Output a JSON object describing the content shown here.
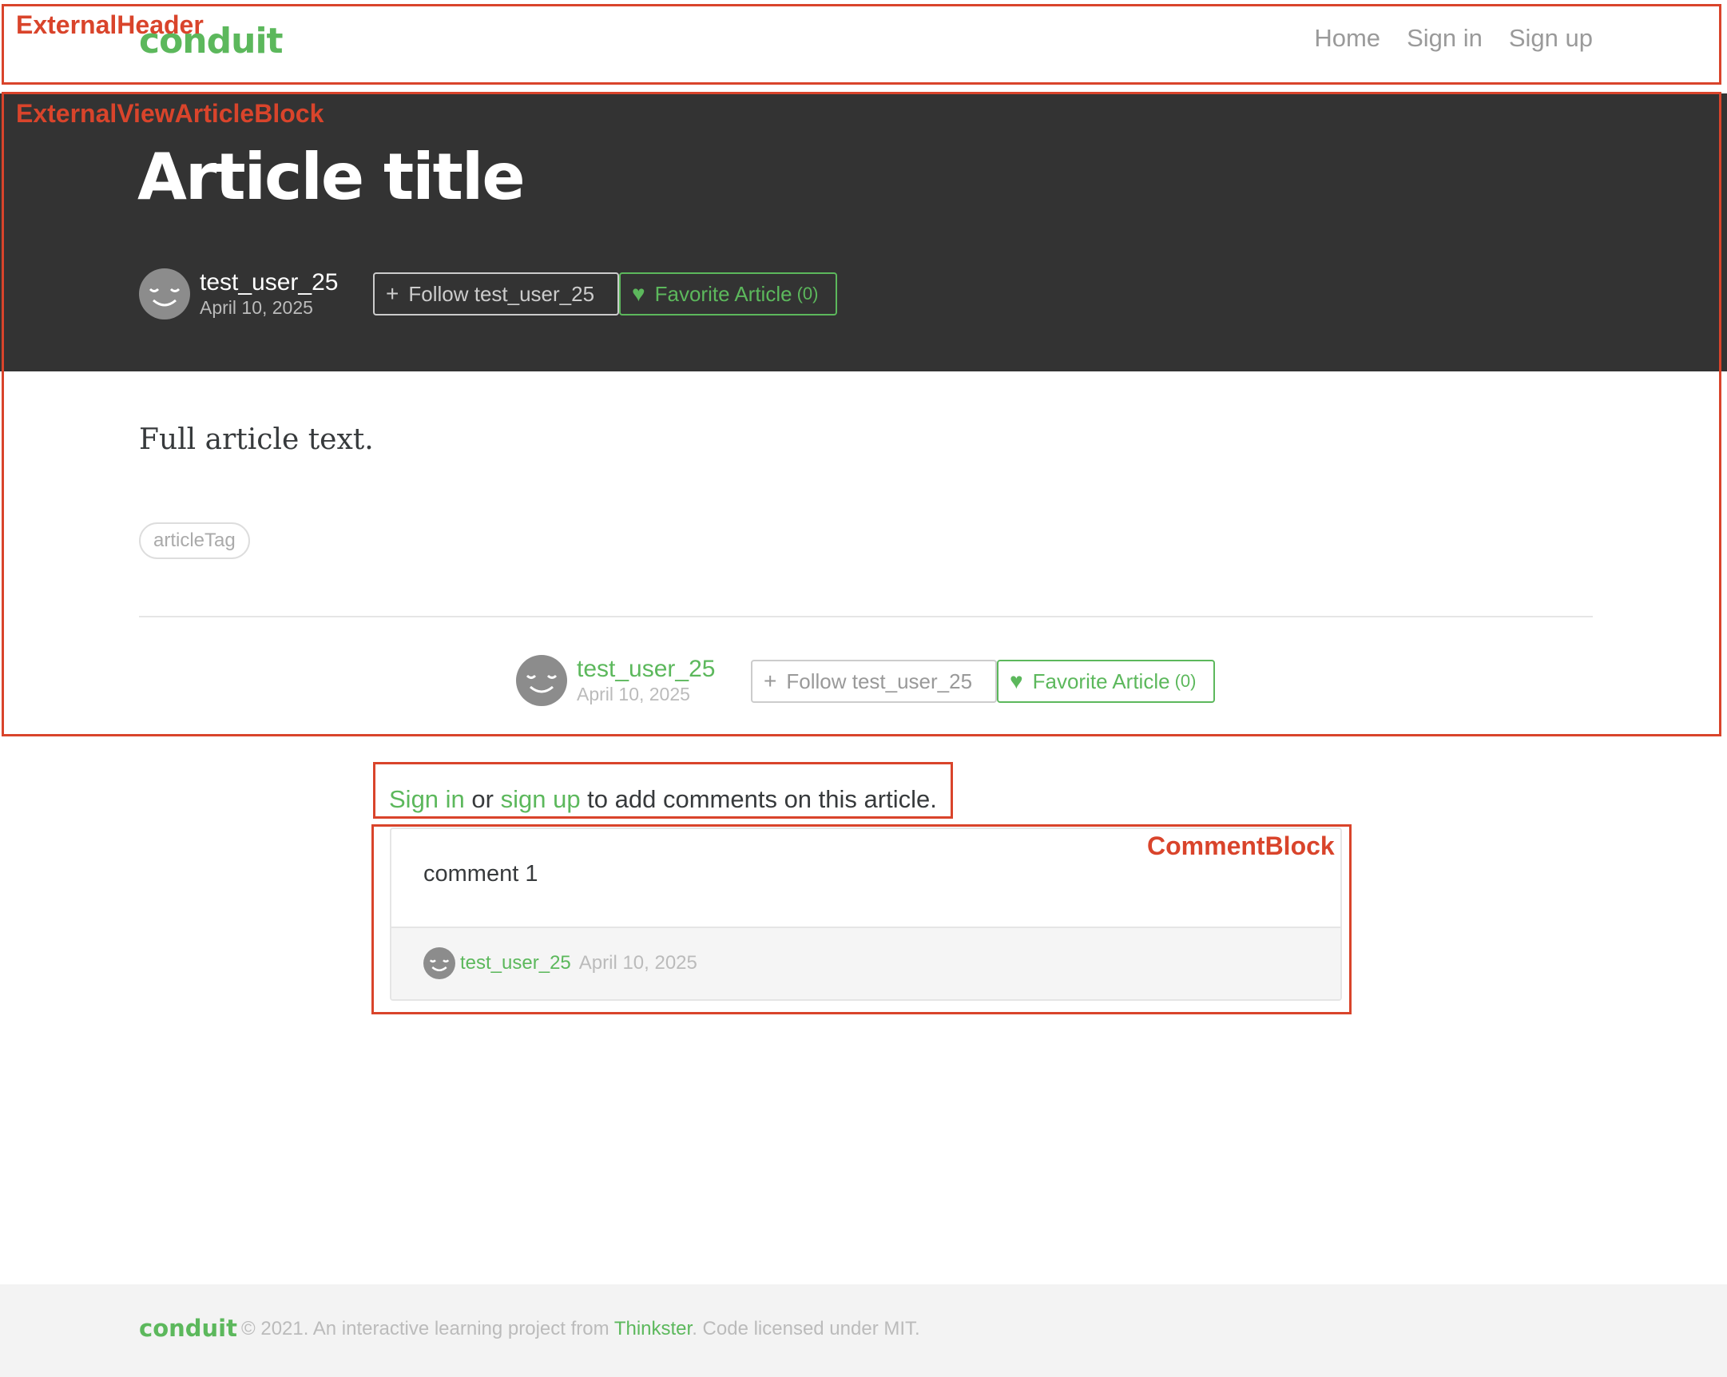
{
  "header": {
    "logo": "conduit",
    "nav": [
      "Home",
      "Sign in",
      "Sign up"
    ]
  },
  "article": {
    "title": "Article title",
    "author": "test_user_25",
    "date": "April 10, 2025",
    "follow_label": "Follow test_user_25",
    "favorite_label": "Favorite Article",
    "favorite_count": "(0)",
    "body": "Full article text.",
    "tags": [
      "articleTag"
    ]
  },
  "comments_prompt": {
    "sign_in": "Sign in",
    "or": " or ",
    "sign_up": "sign up",
    "rest": " to add comments on this article."
  },
  "comments": [
    {
      "text": "comment 1",
      "author": "test_user_25",
      "date": "April 10, 2025"
    }
  ],
  "footer": {
    "logo": "conduit",
    "text_before": "© 2021. An interactive learning project from ",
    "link": "Thinkster",
    "text_after": ". Code licensed under MIT."
  },
  "annotations": {
    "header": "ExternalHeader",
    "article_block": "ExternalViewArticleBlock",
    "comment_block": "CommentBlock"
  },
  "colors": {
    "brand": "#5cb85c",
    "banner": "#333333",
    "annotation": "#d9442b"
  }
}
